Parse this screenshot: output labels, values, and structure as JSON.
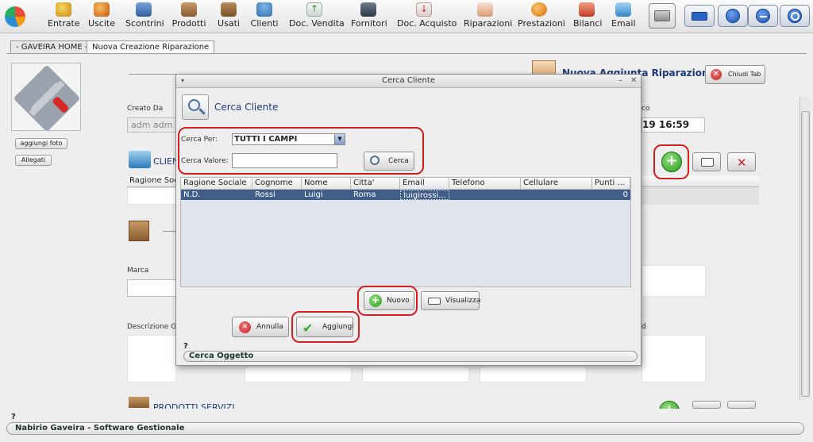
{
  "toolbar": {
    "items": [
      {
        "label": "Entrate",
        "icon": "money-bag-icon",
        "color": "#d9a41b"
      },
      {
        "label": "Uscite",
        "icon": "money-out-icon",
        "color": "#d9741b"
      },
      {
        "label": "Scontrini",
        "icon": "receipt-icon",
        "color": "#3b6fb6"
      },
      {
        "label": "Prodotti",
        "icon": "box-icon",
        "color": "#9a6b3a"
      },
      {
        "label": "Usati",
        "icon": "used-box-icon",
        "color": "#8a5f35"
      },
      {
        "label": "Clienti",
        "icon": "user-icon",
        "color": "#2e7dc2"
      },
      {
        "label": "Doc. Vendita",
        "icon": "sale-document-icon",
        "color": "#3aa34a"
      },
      {
        "label": "Fornitori",
        "icon": "supplier-icon",
        "color": "#445566"
      },
      {
        "label": "Doc. Acquisto",
        "icon": "purchase-document-icon",
        "color": "#c8372d"
      },
      {
        "label": "Riparazioni",
        "icon": "repair-icon",
        "color": "#d26a2c"
      },
      {
        "label": "Prestazioni",
        "icon": "service-icon",
        "color": "#e28a17"
      },
      {
        "label": "Bilanci",
        "icon": "balance-icon",
        "color": "#c23b22"
      },
      {
        "label": "Email",
        "icon": "email-icon",
        "color": "#2f87c9"
      }
    ]
  },
  "tabs": [
    {
      "label": "- GAVEIRA HOME -"
    },
    {
      "label": "Nuova Creazione Riparazione"
    }
  ],
  "form": {
    "add_photo": "aggiungi foto",
    "attachments": "Allegati",
    "header_title": "Nuova Aggiunta Riparazione",
    "close_tab": "Chiudi Tab",
    "created_by_label": "Creato Da",
    "created_by_value": "adm adm",
    "date_value": "19 16:59",
    "date_label_fragment": "co",
    "client_section": "CLIEN",
    "client_grid_col": "Ragione Soc",
    "brand_label": "Marca",
    "desc_label": "Descrizione Gu",
    "desc_label_right": "d",
    "products_section": "PRODOTTI SERVIZI"
  },
  "dialog": {
    "window_title": "Cerca Cliente",
    "header": "Cerca Cliente",
    "search_by_label": "Cerca Per:",
    "search_by_value": "TUTTI I CAMPI",
    "search_value_label": "Cerca Valore:",
    "search_value": "",
    "search_button": "Cerca",
    "columns": [
      "Ragione Sociale",
      "Cognome",
      "Nome",
      "Citta'",
      "Email",
      "Telefono",
      "Cellulare",
      "Punti ..."
    ],
    "rows": [
      [
        "N.D.",
        "Rossi",
        "Luigi",
        "Roma",
        "luigirossi...",
        "",
        "",
        "0"
      ]
    ],
    "new_button": "Nuovo",
    "view_button": "Visualizza",
    "cancel_button": "Annulla",
    "add_button": "Aggiungi",
    "help_mark": "?",
    "find_object": "Cerca Oggetto"
  },
  "status": {
    "help_mark": "?",
    "app_name": "Nabirio Gaveira - Software Gestionale"
  },
  "colors": {
    "selection": "#3f5f8a",
    "highlight_ring": "#d42020",
    "title_blue": "#1f3a7a"
  }
}
